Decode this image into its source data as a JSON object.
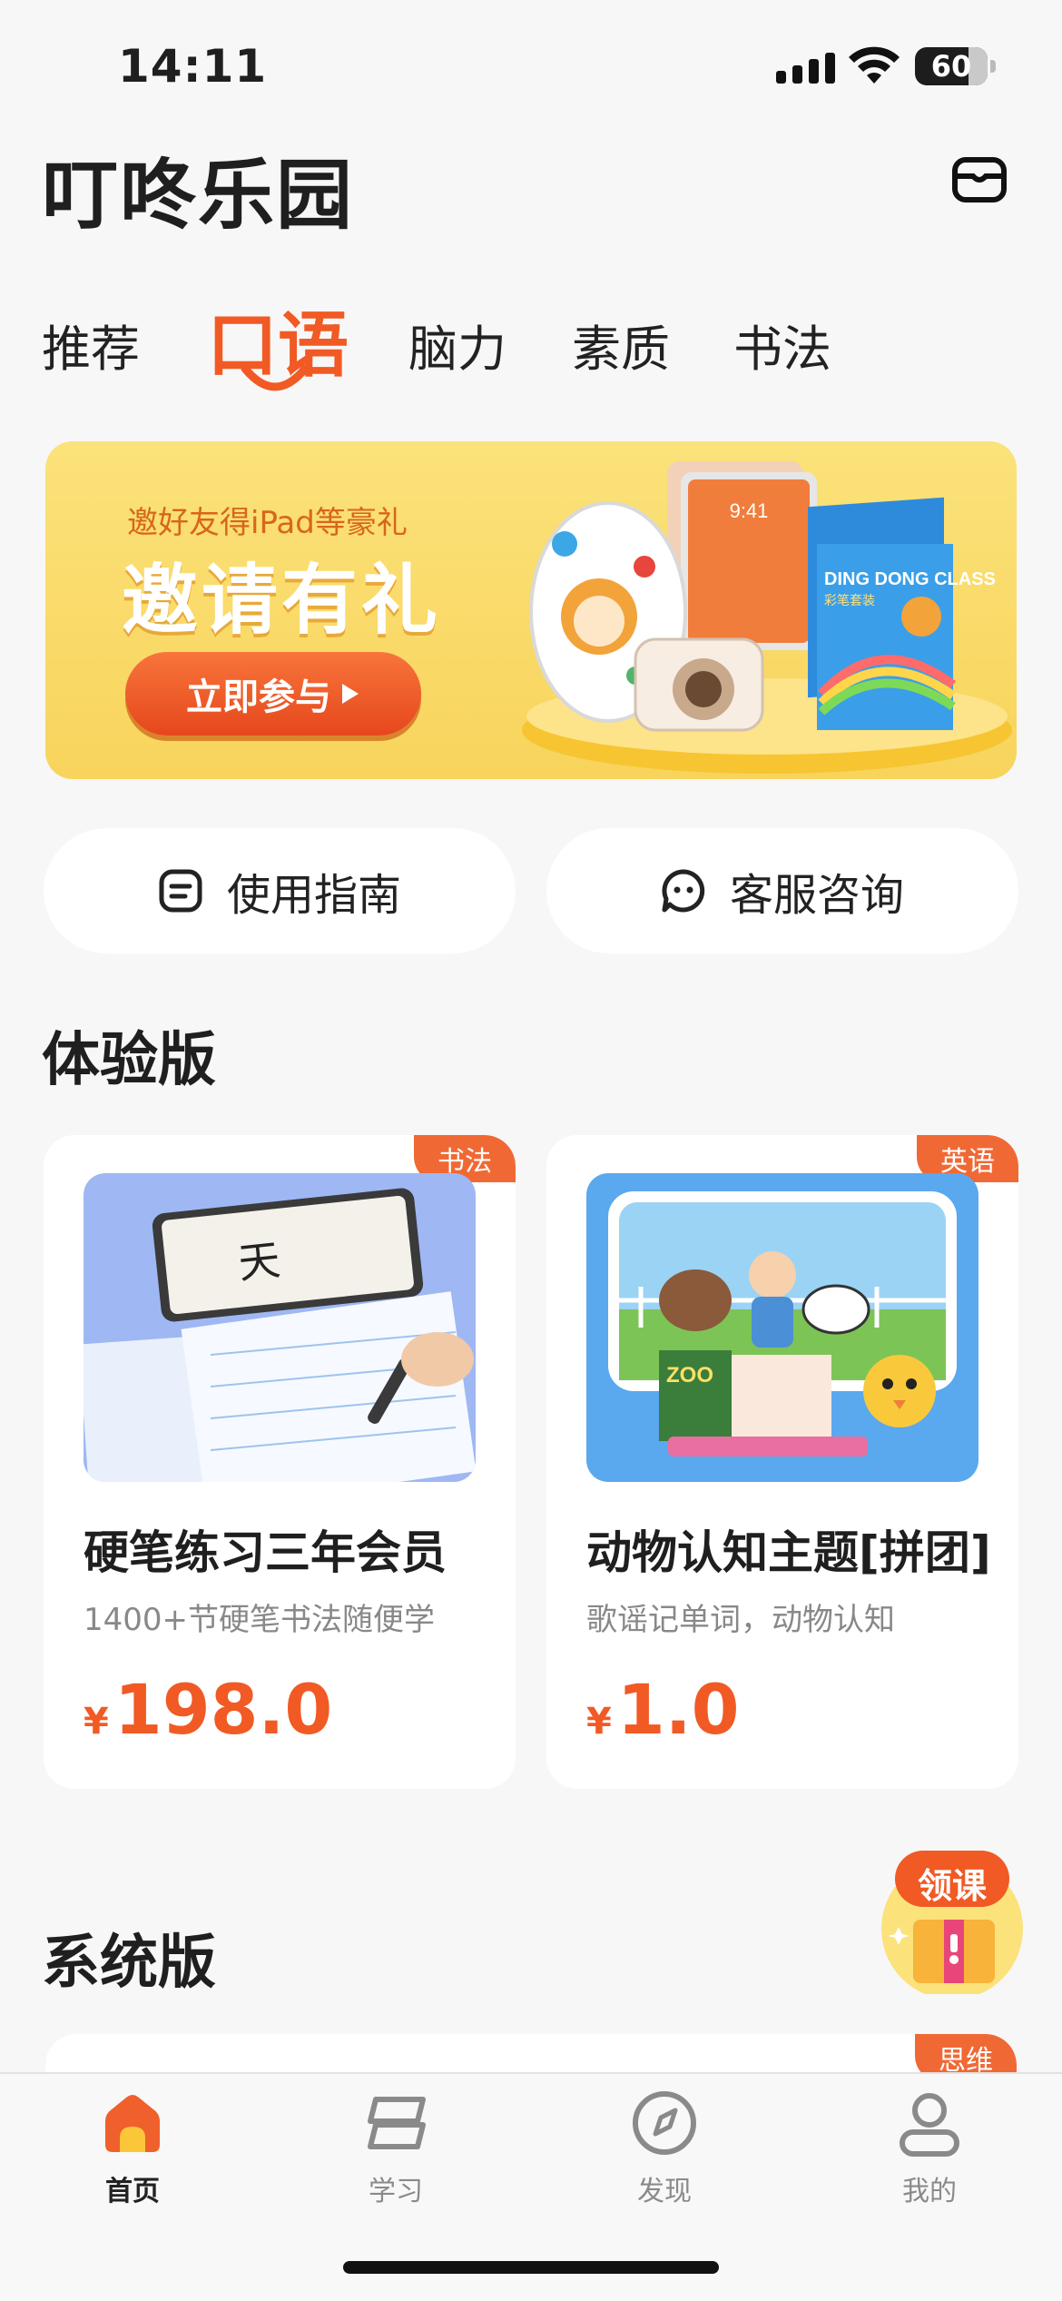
{
  "status_bar": {
    "time": "14:11",
    "battery": "60"
  },
  "header": {
    "title": "叮咚乐园"
  },
  "tabs": [
    {
      "label": "推荐",
      "active": false
    },
    {
      "label": "口语",
      "active": true
    },
    {
      "label": "脑力",
      "active": false
    },
    {
      "label": "素质",
      "active": false
    },
    {
      "label": "书法",
      "active": false
    }
  ],
  "banner": {
    "subtitle": "邀好友得iPad等豪礼",
    "title": "邀请有礼",
    "button_label": "立即参与",
    "art": {
      "tablet_time": "9:41",
      "box_title": "DING DONG CLASS",
      "box_subtitle": "彩笔套装"
    }
  },
  "quick_actions": [
    {
      "label": "使用指南",
      "icon": "document-icon"
    },
    {
      "label": "客服咨询",
      "icon": "chat-face-icon"
    }
  ],
  "trial_section": {
    "title": "体验版",
    "cards": [
      {
        "tag": "书法",
        "title": "硬笔练习三年会员",
        "subtitle": "1400+节硬笔书法随便学",
        "currency": "¥",
        "price": "198.0",
        "image_text": "天"
      },
      {
        "tag": "英语",
        "title": "动物认知主题[拼团]",
        "subtitle": "歌谣记单词，动物认知",
        "currency": "¥",
        "price": "1.0",
        "image_text": "ZOO"
      }
    ]
  },
  "system_section": {
    "title": "系统版",
    "peek_tag": "思维"
  },
  "float_button": {
    "label": "领课"
  },
  "bottom_nav": [
    {
      "label": "首页",
      "icon": "home-icon",
      "active": true
    },
    {
      "label": "学习",
      "icon": "book-stack-icon",
      "active": false
    },
    {
      "label": "发现",
      "icon": "compass-icon",
      "active": false
    },
    {
      "label": "我的",
      "icon": "profile-icon",
      "active": false
    }
  ],
  "colors": {
    "accent": "#f15a24",
    "banner_bg": "#fbe27a",
    "tag_bg": "#f06935"
  }
}
